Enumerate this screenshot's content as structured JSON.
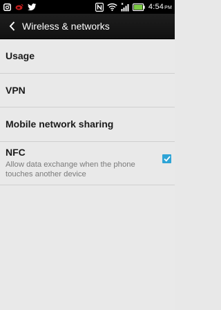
{
  "status_bar": {
    "time": "4:54",
    "ampm": "PM",
    "left_icons": [
      "instagram-icon",
      "weibo-icon",
      "twitter-icon"
    ],
    "right_icons": [
      "nfc-icon",
      "wifi-icon",
      "signal-icon",
      "battery-icon"
    ],
    "accent_color": "#2ea4d6"
  },
  "action_bar": {
    "title": "Wireless & networks",
    "back_icon": "chevron-left-icon"
  },
  "settings": {
    "items": [
      {
        "label": "Usage"
      },
      {
        "label": "VPN"
      },
      {
        "label": "Mobile network sharing"
      },
      {
        "label": "NFC",
        "summary": "Allow data exchange when the phone touches another device",
        "checked": true
      }
    ]
  }
}
